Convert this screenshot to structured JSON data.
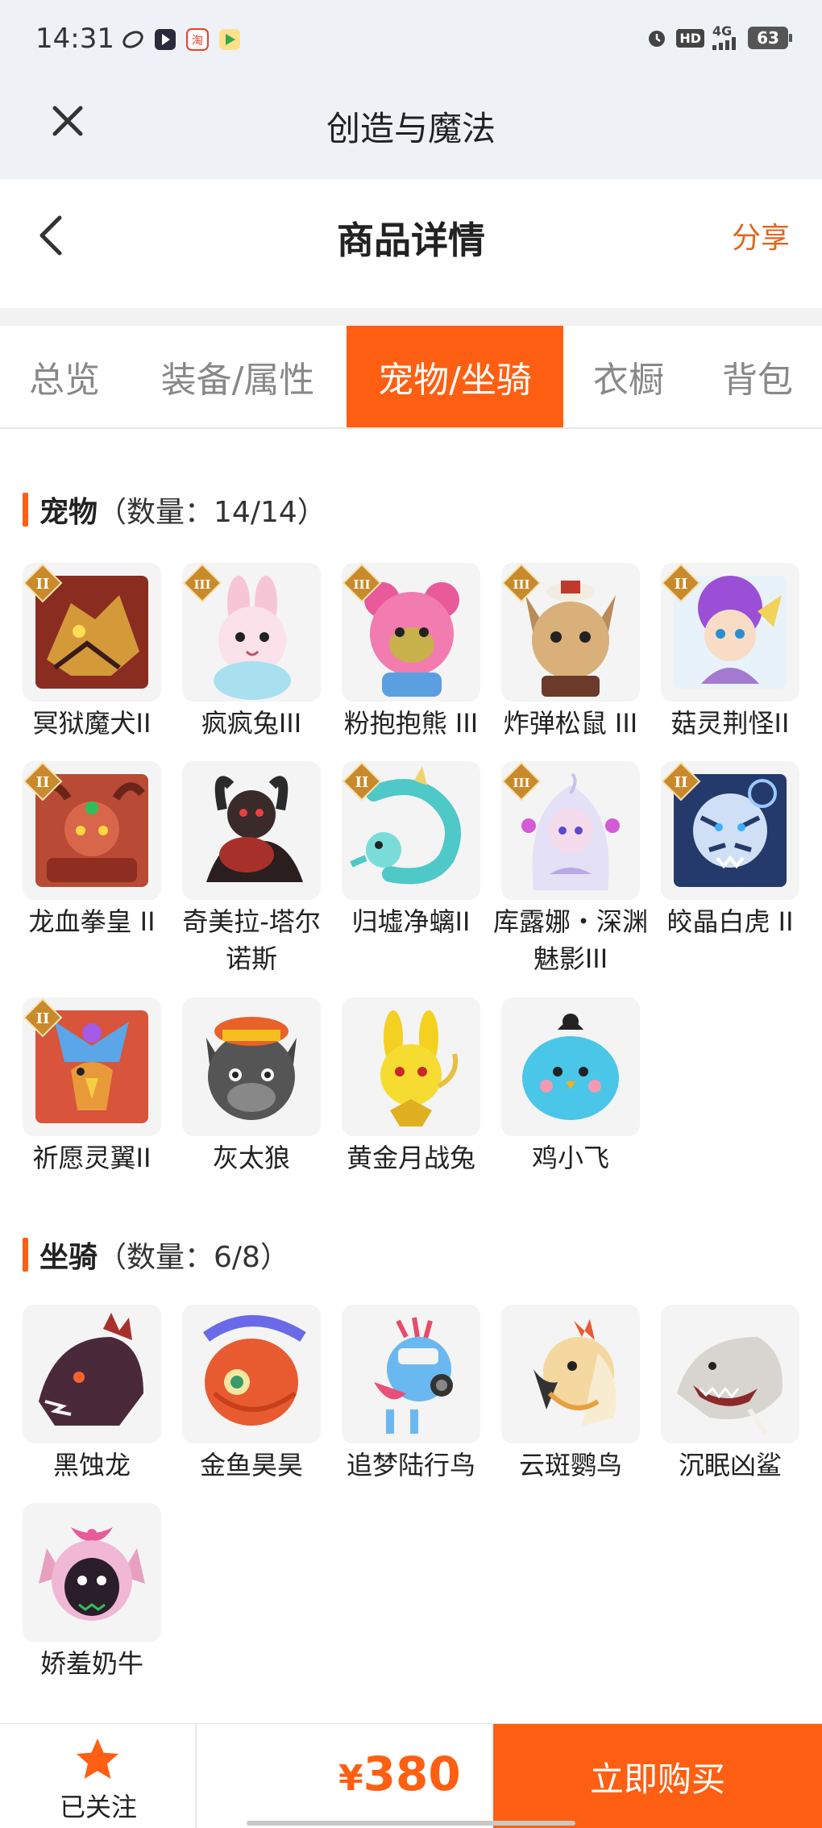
{
  "status_bar": {
    "time": "14:31",
    "hd_label": "HD",
    "network": "4G",
    "battery": "63"
  },
  "app_header": {
    "title": "创造与魔法"
  },
  "page": {
    "title": "商品详情",
    "share_label": "分享"
  },
  "tabs": [
    {
      "label": "总览",
      "active": false
    },
    {
      "label": "装备/属性",
      "active": false
    },
    {
      "label": "宠物/坐骑",
      "active": true
    },
    {
      "label": "衣橱",
      "active": false
    },
    {
      "label": "背包",
      "active": false
    }
  ],
  "pets": {
    "title": "宠物",
    "count_text": "（数量：14/14）",
    "items": [
      {
        "name": "冥狱魔犬II",
        "rank": "II"
      },
      {
        "name": "疯疯兔III",
        "rank": "III"
      },
      {
        "name": "粉抱抱熊 III",
        "rank": "III"
      },
      {
        "name": "炸弹松鼠 III",
        "rank": "III"
      },
      {
        "name": "菇灵荆怪II",
        "rank": "II"
      },
      {
        "name": "龙血拳皇 II",
        "rank": "II"
      },
      {
        "name": "奇美拉-塔尔诺斯",
        "rank": ""
      },
      {
        "name": "归墟净螭II",
        "rank": "II"
      },
      {
        "name": "库露娜・深渊魅影III",
        "rank": "III"
      },
      {
        "name": "皎晶白虎 II",
        "rank": "II"
      },
      {
        "name": "祈愿灵翼II",
        "rank": "II"
      },
      {
        "name": "灰太狼",
        "rank": ""
      },
      {
        "name": "黄金月战兔",
        "rank": ""
      },
      {
        "name": "鸡小飞",
        "rank": ""
      }
    ]
  },
  "mounts": {
    "title": "坐骑",
    "count_text": "（数量：6/8）",
    "items": [
      {
        "name": "黑蚀龙"
      },
      {
        "name": "金鱼昊昊"
      },
      {
        "name": "追梦陆行鸟"
      },
      {
        "name": "云斑鹦鸟"
      },
      {
        "name": "沉眠凶鲨"
      },
      {
        "name": "娇羞奶牛"
      }
    ]
  },
  "bottom_bar": {
    "follow_label": "已关注",
    "price_symbol": "¥",
    "price_value": "380",
    "buy_label": "立即购买"
  },
  "colors": {
    "accent": "#fe5f12",
    "share": "#e0661c",
    "header_bg": "#eef2f7"
  }
}
